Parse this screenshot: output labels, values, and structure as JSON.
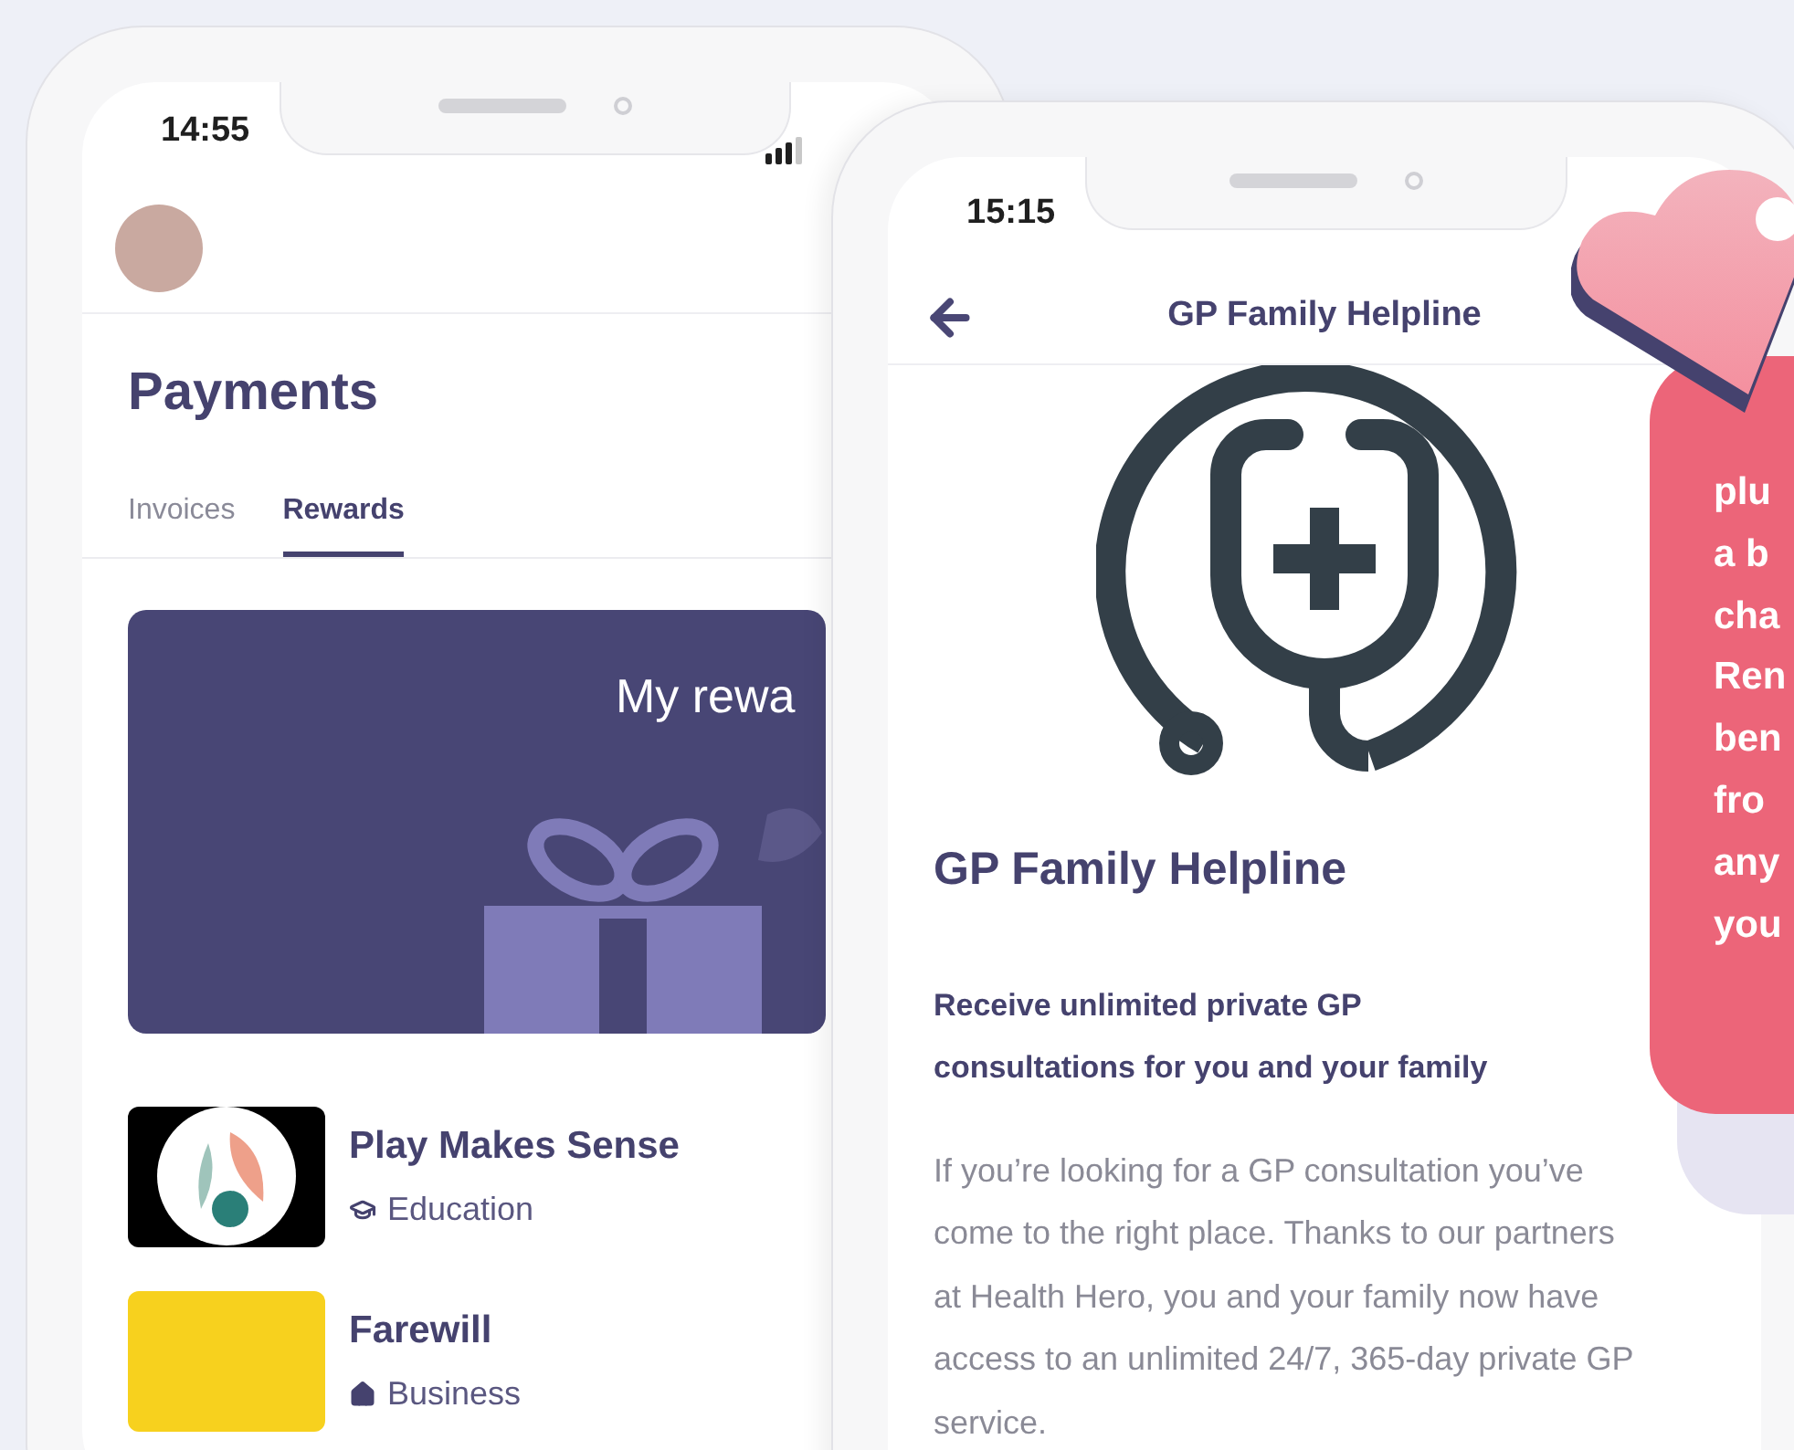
{
  "payments_screen": {
    "status_time": "14:55",
    "title": "Payments",
    "tabs": [
      {
        "label": "Invoices",
        "selected": false
      },
      {
        "label": "Rewards",
        "selected": true
      }
    ],
    "rewards_card": {
      "title": "My rewa"
    },
    "rewards": [
      {
        "name": "Play Makes Sense",
        "category": "Education",
        "kind": "education"
      },
      {
        "name": "Farewill",
        "category": "Business",
        "kind": "business"
      }
    ]
  },
  "helpline_screen": {
    "status_time": "15:15",
    "header_title": "GP Family Helpline",
    "heading": "GP Family Helpline",
    "subtitle": "Receive unlimited private GP consultations for you and your family",
    "body": "If you’re looking for a GP consultation you’ve come to the right place. Thanks to our partners at Health Hero, you and your family now have access to an unlimited 24/7, 365-day private GP service."
  },
  "promo_card": {
    "lines": [
      "plu",
      "a b",
      "cha",
      "Ren",
      "ben",
      "fro",
      "any",
      "you"
    ]
  }
}
